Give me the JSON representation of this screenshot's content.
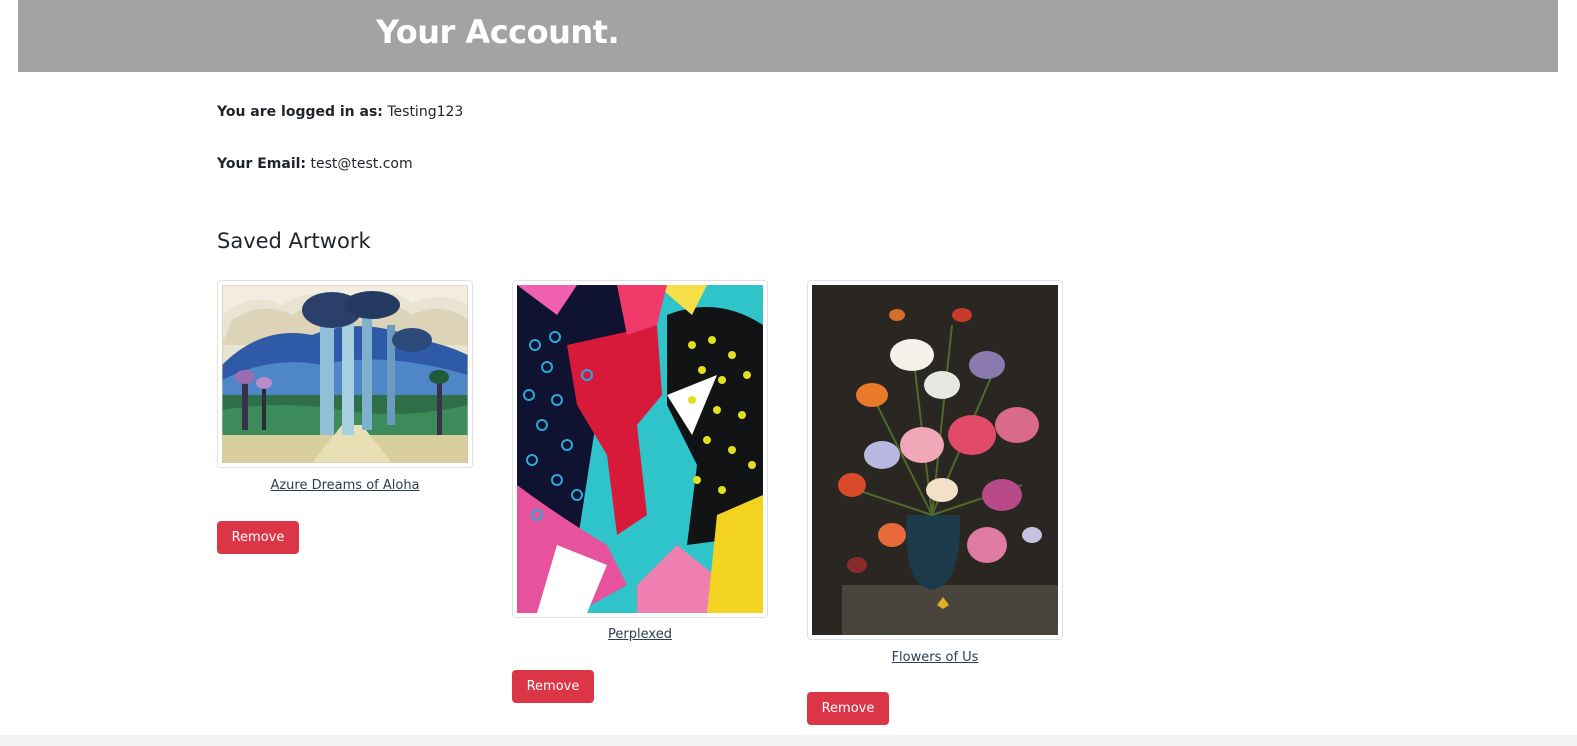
{
  "header": {
    "title": "Your Account."
  },
  "account": {
    "logged_in_label": "You are logged in as:",
    "username": "Testing123",
    "email_label": "Your Email:",
    "email": "test@test.com"
  },
  "saved": {
    "heading": "Saved Artwork",
    "items": [
      {
        "title": "Azure Dreams of Aloha",
        "remove_label": "Remove"
      },
      {
        "title": "Perplexed",
        "remove_label": "Remove"
      },
      {
        "title": "Flowers of Us",
        "remove_label": "Remove"
      }
    ]
  },
  "colors": {
    "header_bg": "#a3a3a3",
    "remove_button": "#dc3545",
    "link": "#2d3e50"
  }
}
